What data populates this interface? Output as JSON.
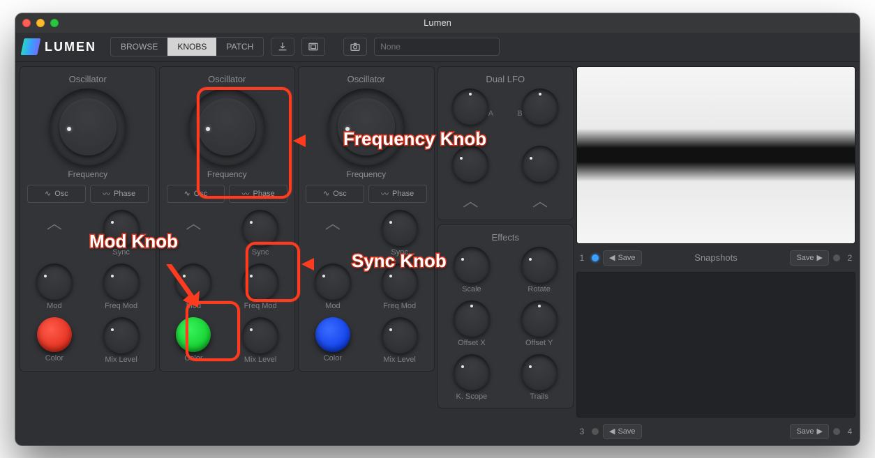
{
  "window": {
    "title": "Lumen"
  },
  "app": {
    "name": "LUMEN"
  },
  "tabs": {
    "browse": "BROWSE",
    "knobs": "KNOBS",
    "patch": "PATCH",
    "active": "knobs"
  },
  "search": {
    "placeholder": "None"
  },
  "osc": {
    "title": "Oscillator",
    "freq_label": "Frequency",
    "btn_osc": "Osc",
    "btn_phase": "Phase",
    "labels": {
      "sync": "Sync",
      "mod": "Mod",
      "freq_mod": "Freq Mod",
      "color": "Color",
      "mix": "Mix Level"
    }
  },
  "lfo": {
    "title": "Dual LFO",
    "a": "A",
    "b": "B"
  },
  "effects": {
    "title": "Effects",
    "labels": {
      "scale": "Scale",
      "rotate": "Rotate",
      "offx": "Offset X",
      "offy": "Offset Y",
      "kscope": "K. Scope",
      "trails": "Trails"
    }
  },
  "snapshots": {
    "title": "Snapshots",
    "save": "Save",
    "slots": {
      "s1": "1",
      "s2": "2",
      "s3": "3",
      "s4": "4"
    }
  },
  "annotations": {
    "freq": "Frequency Knob",
    "sync": "Sync Knob",
    "mod": "Mod Knob"
  }
}
